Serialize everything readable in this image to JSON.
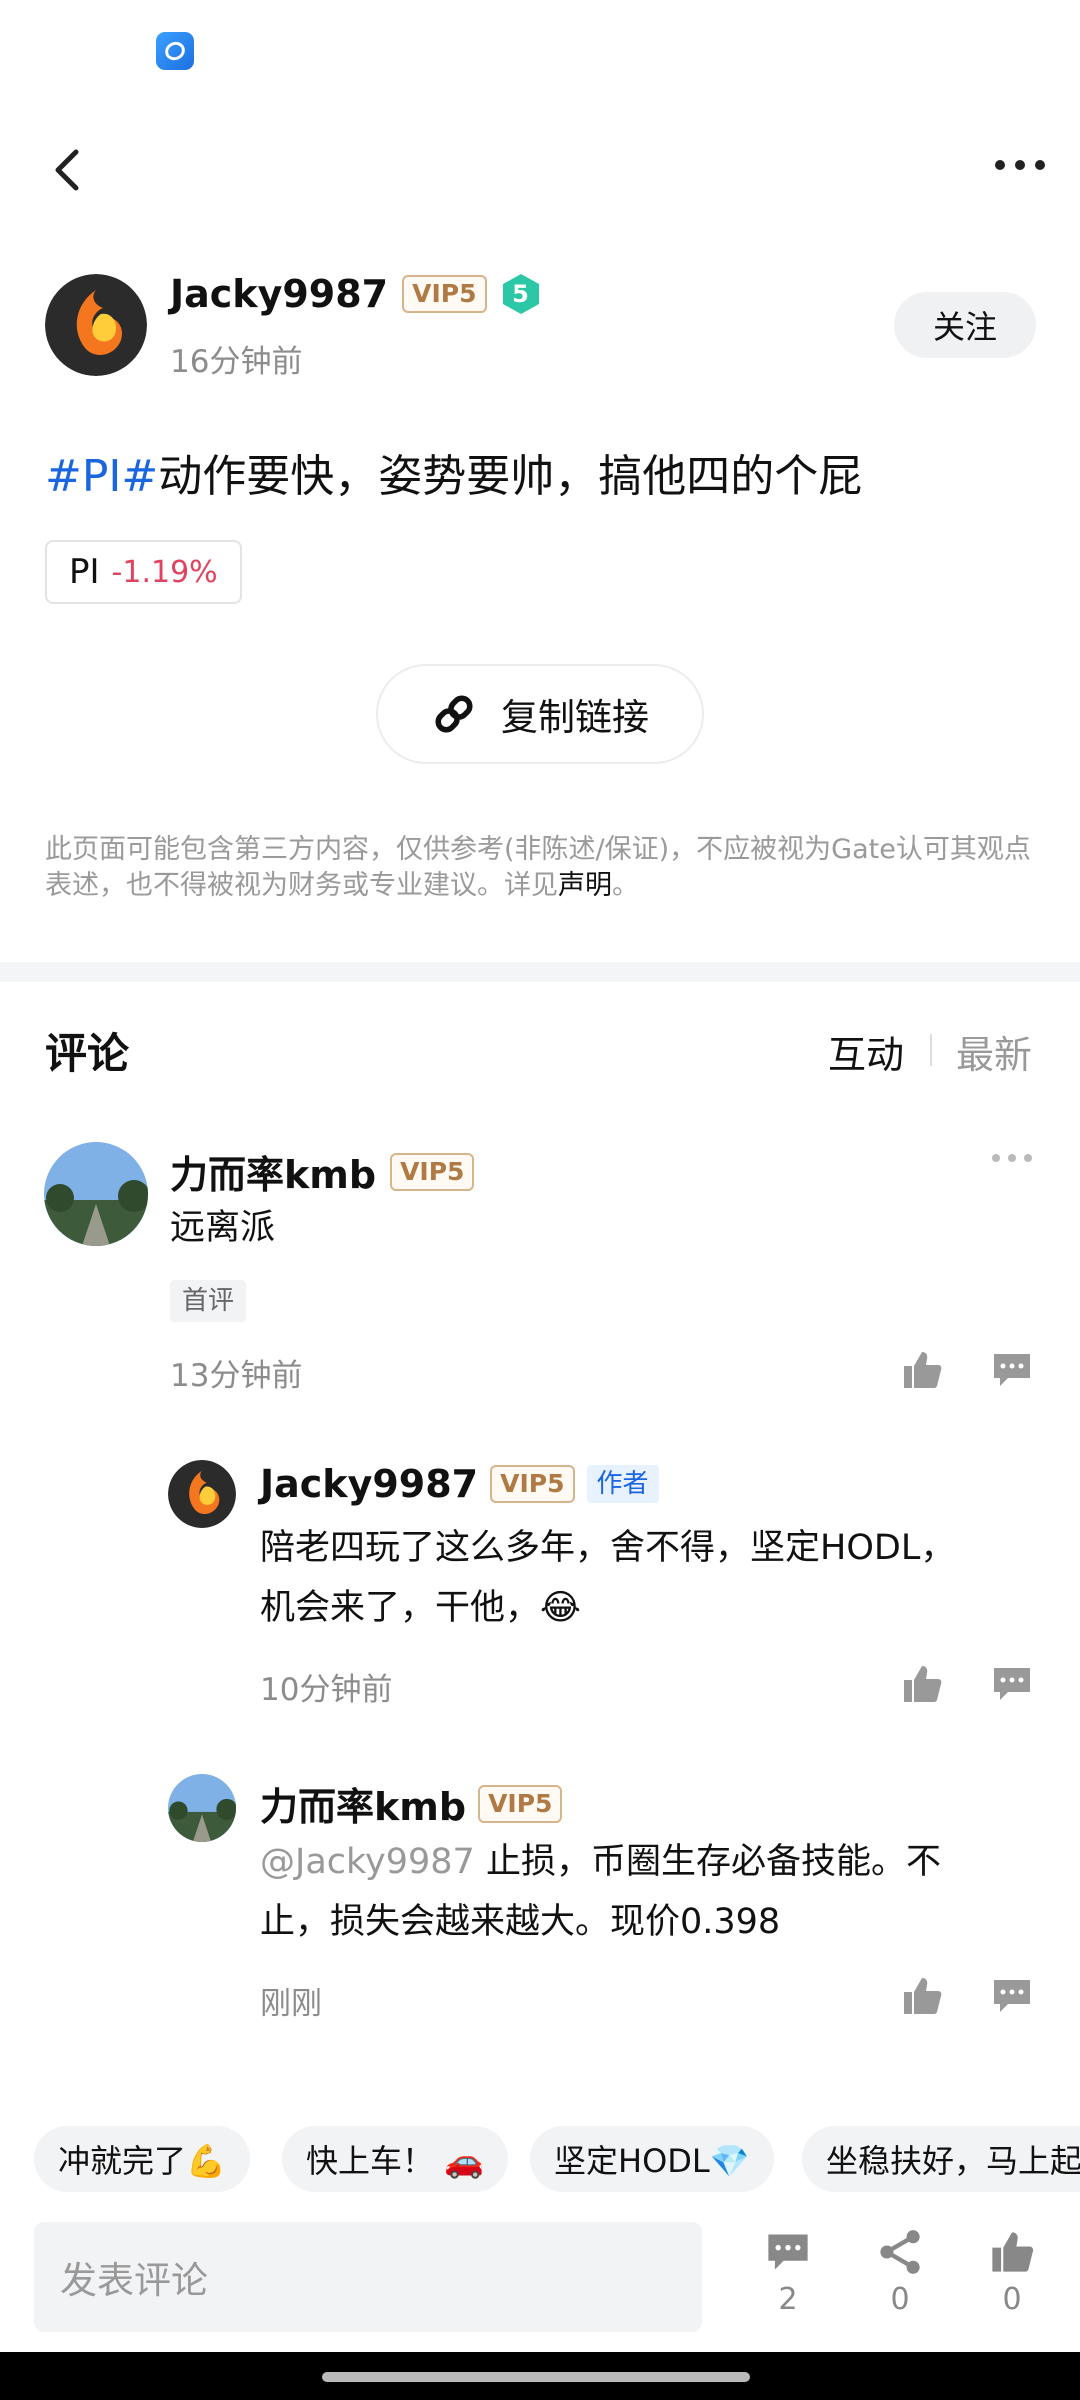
{
  "header": {
    "back_icon": "chevron-left-icon",
    "more_icon": "more-dots-icon"
  },
  "author": {
    "name": "Jacky9987",
    "vip": "VIP5",
    "level": "5",
    "time": "16分钟前",
    "follow_label": "关注"
  },
  "post": {
    "tag": "#PI#",
    "text": "动作要快，姿势要帅，搞他四的个屁"
  },
  "coin": {
    "symbol": "PI",
    "change": "-1.19%",
    "change_color": "#e0425f"
  },
  "copy_link_label": "复制链接",
  "disclaimer": {
    "text": "此页面可能包含第三方内容，仅供参考(非陈述/保证)，不应被视为Gate认可其观点表述，也不得被视为财务或专业建议。详见",
    "link": "声明",
    "end": "。"
  },
  "comments_section": {
    "title": "评论",
    "tab_interactive": "互动",
    "tab_latest": "最新"
  },
  "comments": [
    {
      "name": "力而率kmb",
      "vip": "VIP5",
      "text": "远离派",
      "badge": "首评",
      "time": "13分钟前"
    },
    {
      "name": "Jacky9987",
      "vip": "VIP5",
      "author_badge": "作者",
      "text_line1": "陪老四玩了这么多年，舍不得，坚定HODL，",
      "text_line2": "机会来了，干他，😂",
      "time": "10分钟前"
    },
    {
      "name": "力而率kmb",
      "vip": "VIP5",
      "mention": "@Jacky9987",
      "text_line1": " 止损，币圈生存必备技能。不",
      "text_line2": "止，损失会越来越大。现价0.398",
      "time": "刚刚"
    }
  ],
  "quick_replies": [
    "冲就完了💪",
    "快上车！ 🚗",
    "坚定HODL💎",
    "坐稳扶好，马上起"
  ],
  "bottom_bar": {
    "placeholder": "发表评论",
    "comment_count": "2",
    "share_count": "0",
    "like_count": "0"
  }
}
